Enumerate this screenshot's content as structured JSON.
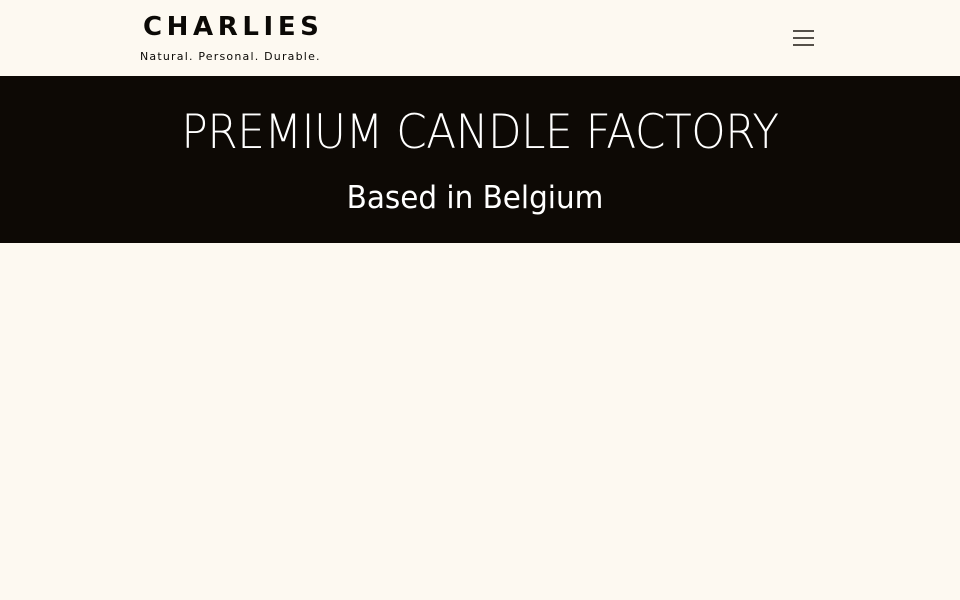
{
  "header": {
    "logo_name": "CHARLIES",
    "tagline": "Natural. Personal. Durable.",
    "menu_icon": "hamburger-menu-icon"
  },
  "hero": {
    "title": "PREMIUM CANDLE FACTORY",
    "subtitle": "Based in Belgium"
  },
  "colors": {
    "background": "#fdf9f1",
    "hero_background": "#0d0905",
    "text_dark": "#0b0906",
    "text_light": "#ffffff",
    "menu_icon": "#555049"
  }
}
